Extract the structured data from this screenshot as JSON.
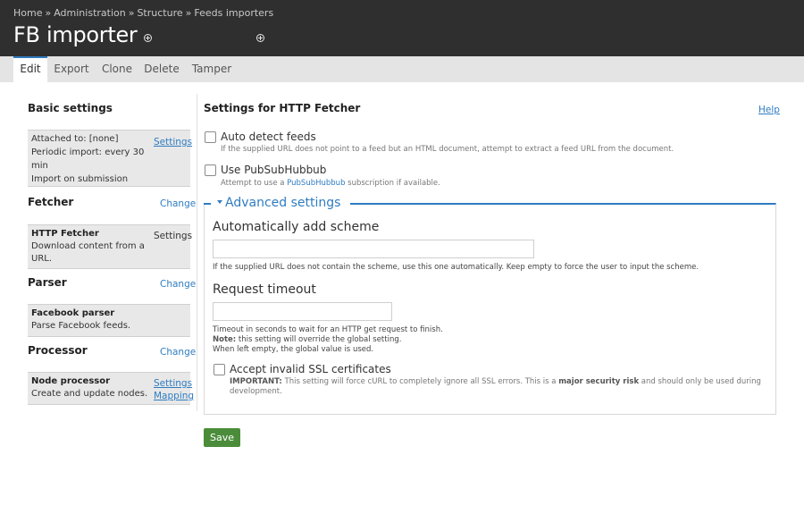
{
  "header": {
    "breadcrumb": [
      "Home",
      "Administration",
      "Structure",
      "Feeds importers"
    ],
    "breadcrumb_sep": "»",
    "title": "FB importer"
  },
  "tabs": [
    "Edit",
    "Export",
    "Clone",
    "Delete",
    "Tamper"
  ],
  "active_tab": "Edit",
  "sidebar": {
    "basic": {
      "heading": "Basic settings",
      "lines": [
        "Attached to: [none]",
        "Periodic import: every 30",
        "min",
        "Import on submission"
      ],
      "link": "Settings"
    },
    "fetcher": {
      "heading": "Fetcher",
      "change": "Change",
      "name": "HTTP Fetcher",
      "desc": [
        "Download content from a",
        "URL."
      ],
      "link": "Settings"
    },
    "parser": {
      "heading": "Parser",
      "change": "Change",
      "name": "Facebook parser",
      "desc": "Parse Facebook feeds."
    },
    "processor": {
      "heading": "Processor",
      "change": "Change",
      "name": "Node processor",
      "desc": "Create and update nodes.",
      "links": [
        "Settings",
        "Mapping"
      ]
    }
  },
  "main": {
    "heading": "Settings for HTTP Fetcher",
    "help": "Help",
    "auto_detect": {
      "label": "Auto detect feeds",
      "desc": "If the supplied URL does not point to a feed but an HTML document, attempt to extract a feed URL from the document."
    },
    "pubsub": {
      "label": "Use PubSubHubbub",
      "desc_before": "Attempt to use a ",
      "desc_link": "PubSubHubbub",
      "desc_after": " subscription if available."
    },
    "advanced": {
      "legend": "Advanced settings",
      "scheme": {
        "label": "Automatically add scheme",
        "value": "",
        "desc": "If the supplied URL does not contain the scheme, use this one automatically. Keep empty to force the user to input the scheme."
      },
      "timeout": {
        "label": "Request timeout",
        "value": "",
        "desc1": "Timeout in seconds to wait for an HTTP get request to finish.",
        "note_label": "Note:",
        "desc2": " this setting will override the global setting.",
        "desc3": "When left empty, the global value is used."
      },
      "ssl": {
        "label": "Accept invalid SSL certificates",
        "imp_label": "IMPORTANT:",
        "desc_part1": " This setting will force cURL to completely ignore all SSL errors. This is a ",
        "desc_bold": "major security risk",
        "desc_part2": " and should only be used during",
        "desc_line2": "development."
      }
    },
    "save": "Save"
  },
  "colors": {
    "header_bg": "#2f2f2f",
    "link": "#2f7cc1",
    "save_button": "#4b8c3a"
  }
}
